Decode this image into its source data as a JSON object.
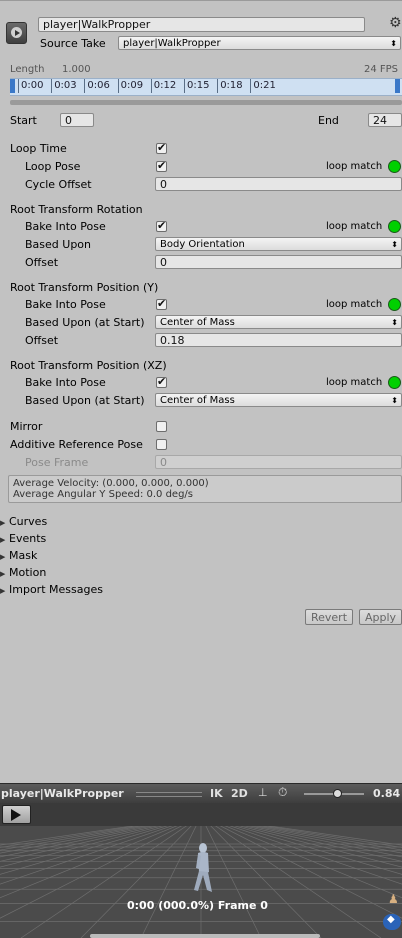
{
  "header": {
    "clip_name_value": "player|WalkPropper",
    "source_take_label": "Source Take",
    "source_take_value": "player|WalkPropper",
    "settings_icon": "gear-icon",
    "clip_icon": "play-icon"
  },
  "timeline": {
    "length_label": "Length",
    "length_value": "1.000",
    "fps": "24 FPS",
    "ticks": [
      "0:00",
      "0:03",
      "0:06",
      "0:09",
      "0:12",
      "0:15",
      "0:18",
      "0:21"
    ]
  },
  "range": {
    "start_label": "Start",
    "start_value": "0",
    "end_label": "End",
    "end_value": "24"
  },
  "loop_time": {
    "label": "Loop Time",
    "checked": true,
    "loop_pose_label": "Loop Pose",
    "loop_pose_checked": true,
    "loop_match_label": "loop match",
    "cycle_offset_label": "Cycle Offset",
    "cycle_offset_value": "0"
  },
  "rotation": {
    "title": "Root Transform Rotation",
    "bake_label": "Bake Into Pose",
    "bake_checked": true,
    "loop_match_label": "loop match",
    "based_upon_label": "Based Upon",
    "based_upon_value": "Body Orientation",
    "offset_label": "Offset",
    "offset_value": "0"
  },
  "position_y": {
    "title": "Root Transform Position (Y)",
    "bake_label": "Bake Into Pose",
    "bake_checked": true,
    "loop_match_label": "loop match",
    "based_upon_label": "Based Upon (at Start)",
    "based_upon_value": "Center of Mass",
    "offset_label": "Offset",
    "offset_value": "0.18"
  },
  "position_xz": {
    "title": "Root Transform Position (XZ)",
    "bake_label": "Bake Into Pose",
    "bake_checked": true,
    "loop_match_label": "loop match",
    "based_upon_label": "Based Upon (at Start)",
    "based_upon_value": "Center of Mass"
  },
  "misc": {
    "mirror_label": "Mirror",
    "mirror_checked": false,
    "additive_label": "Additive Reference Pose",
    "additive_checked": false,
    "pose_frame_label": "Pose Frame",
    "pose_frame_value": "0"
  },
  "info": {
    "avg_velocity": "Average Velocity: (0.000, 0.000, 0.000)",
    "avg_angular": "Average Angular Y Speed: 0.0 deg/s"
  },
  "foldouts": [
    "Curves",
    "Events",
    "Mask",
    "Motion",
    "Import Messages"
  ],
  "buttons": {
    "revert": "Revert",
    "apply": "Apply"
  },
  "preview": {
    "title": "player|WalkPropper",
    "ik": "IK",
    "two_d": "2D",
    "speed_value": "0.84",
    "speed_fraction": 0.55,
    "status": "0:00 (000.0%) Frame 0"
  },
  "colors": {
    "loop_match_ok": "#00d000",
    "timeline_bg": "#cfe0f2",
    "preview_bg": "#4a4a4a"
  }
}
